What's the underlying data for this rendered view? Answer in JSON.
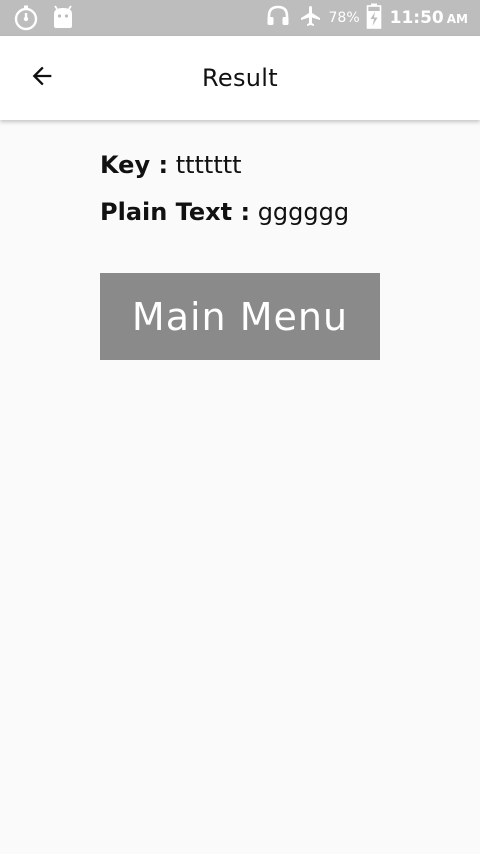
{
  "status_bar": {
    "left_icons": [
      "timer-icon",
      "android-icon"
    ],
    "right_icons": [
      "headset-icon",
      "airplane-mode-icon",
      "battery-icon"
    ],
    "battery_percent": "78%",
    "time": "11:50",
    "ampm": "AM",
    "background": "#bdbdbd"
  },
  "appbar": {
    "title": "Result",
    "back_icon": "arrow-left-icon"
  },
  "result": {
    "key_label": "Key :",
    "key_value": "ttttttt",
    "plain_label": "Plain Text :",
    "plain_value": "gggggg"
  },
  "main_menu_button": {
    "label": "Main Menu",
    "background": "#8a8a8a"
  }
}
